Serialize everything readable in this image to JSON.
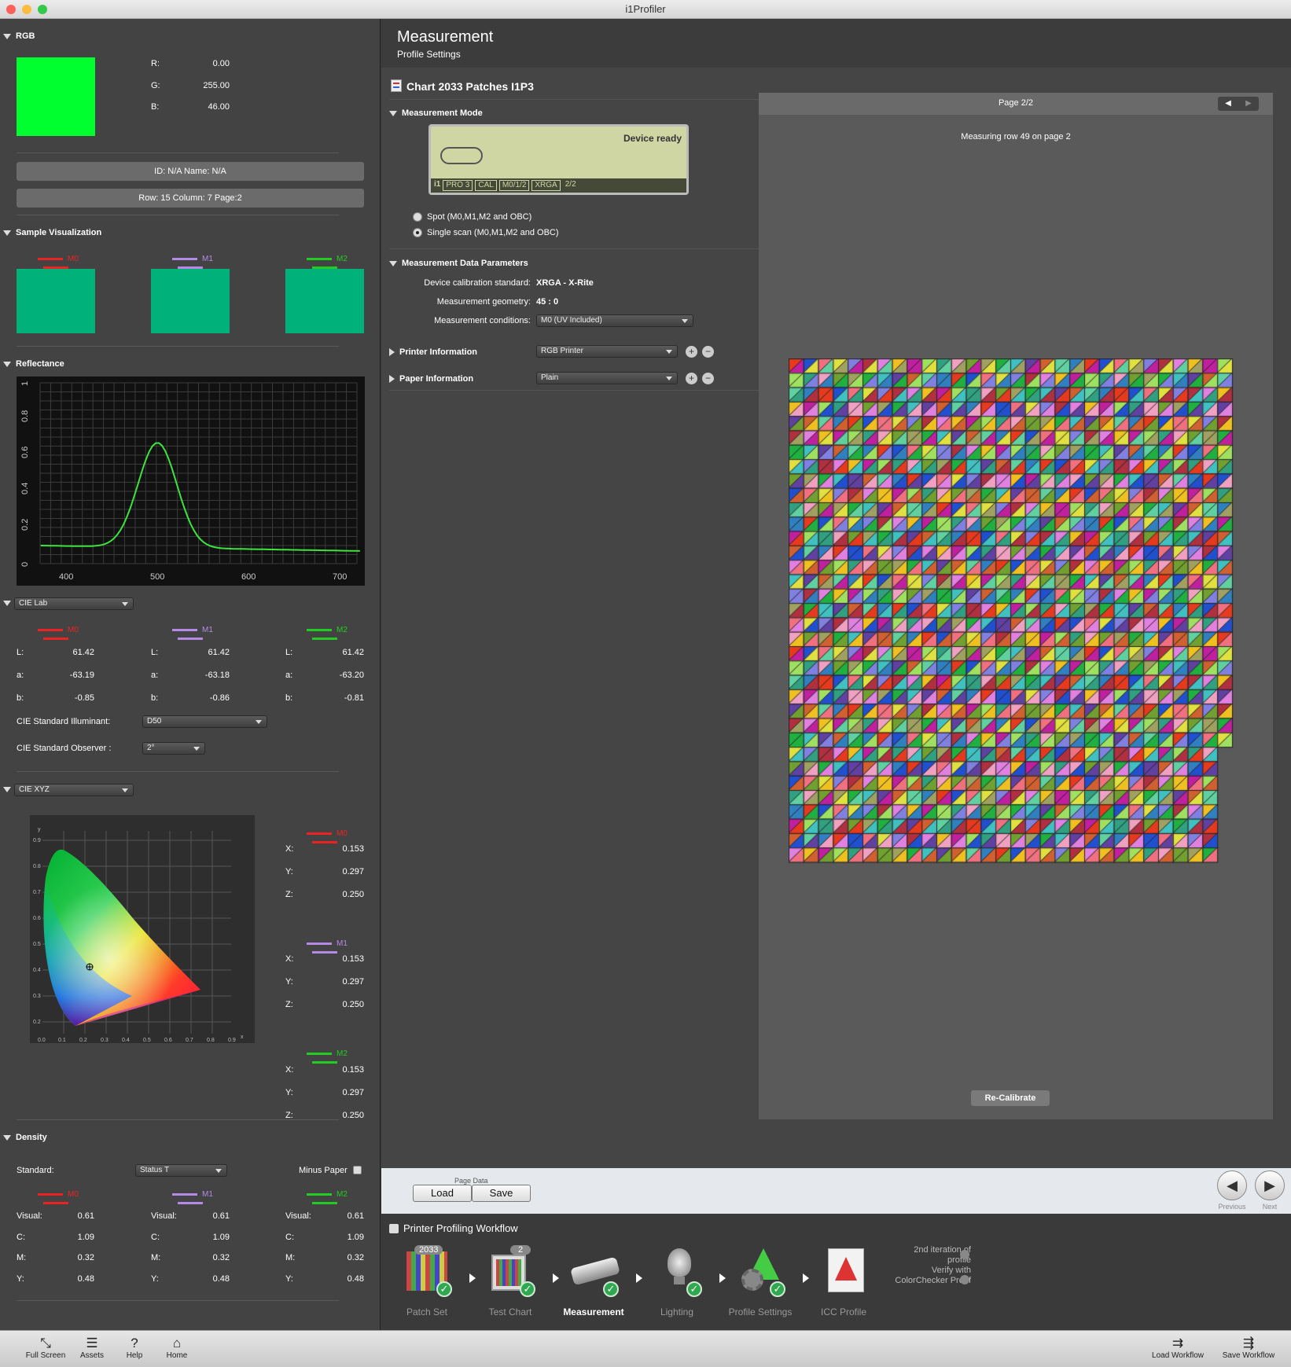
{
  "window": {
    "title": "i1Profiler"
  },
  "rgb": {
    "heading": "RGB",
    "swatch_color": "#00ff2e",
    "r_label": "R:",
    "r": "0.00",
    "g_label": "G:",
    "g": "255.00",
    "b_label": "B:",
    "b": "46.00",
    "id_name": "ID: N/A     Name: N/A",
    "row_col_page": "Row: 15    Column: 7    Page:2"
  },
  "sample": {
    "heading": "Sample Visualization",
    "m0": "M0",
    "m1": "M1",
    "m2": "M2",
    "color": "#00b17a"
  },
  "reflectance": {
    "heading": "Reflectance",
    "yticks": [
      "0",
      "0.2",
      "0.4",
      "0.6",
      "0.8",
      "1"
    ],
    "xticks": [
      "400",
      "500",
      "600",
      "700"
    ]
  },
  "lab": {
    "dropdown": "CIE Lab",
    "m0": "M0",
    "m1": "M1",
    "m2": "M2",
    "L_label": "L:",
    "a_label": "a:",
    "b_label": "b:",
    "cols": [
      {
        "L": "61.42",
        "a": "-63.19",
        "b": "-0.85"
      },
      {
        "L": "61.42",
        "a": "-63.18",
        "b": "-0.86"
      },
      {
        "L": "61.42",
        "a": "-63.20",
        "b": "-0.81"
      }
    ],
    "illuminant_label": "CIE Standard Illuminant:",
    "illuminant": "D50",
    "observer_label": "CIE Standard Observer :",
    "observer": "2°"
  },
  "xyz": {
    "dropdown": "CIE XYZ",
    "m0": "M0",
    "m1": "M1",
    "m2": "M2",
    "X_label": "X:",
    "Y_label": "Y:",
    "Z_label": "Z:",
    "groups": [
      {
        "X": "0.153",
        "Y": "0.297",
        "Z": "0.250"
      },
      {
        "X": "0.153",
        "Y": "0.297",
        "Z": "0.250"
      },
      {
        "X": "0.153",
        "Y": "0.297",
        "Z": "0.250"
      }
    ]
  },
  "density": {
    "heading": "Density",
    "standard_label": "Standard:",
    "standard": "Status T",
    "minus_paper": "Minus Paper",
    "m0": "M0",
    "m1": "M1",
    "m2": "M2",
    "visual_label": "Visual:",
    "c_label": "C:",
    "m_label": "M:",
    "y_label": "Y:",
    "cols": [
      {
        "visual": "0.61",
        "c": "1.09",
        "m": "0.32",
        "y": "0.48"
      },
      {
        "visual": "0.61",
        "c": "1.09",
        "m": "0.32",
        "y": "0.48"
      },
      {
        "visual": "0.61",
        "c": "1.09",
        "m": "0.32",
        "y": "0.48"
      }
    ]
  },
  "header": {
    "title": "Measurement",
    "subtitle": "Profile Settings"
  },
  "chart": {
    "title": "Chart 2033 Patches I1P3"
  },
  "mode": {
    "heading": "Measurement Mode",
    "lcd_status": "Device ready",
    "lcd_device": "i1",
    "lcd_pro": "PRO 3",
    "lcd_cal": "CAL",
    "lcd_m": "M0/1/2",
    "lcd_xrga": "XRGA",
    "lcd_page": "2/2",
    "spot": "Spot (M0,M1,M2 and OBC)",
    "single": "Single scan (M0,M1,M2 and OBC)"
  },
  "params": {
    "heading": "Measurement Data Parameters",
    "cal_label": "Device calibration standard:",
    "cal": "XRGA - X-Rite",
    "geo_label": "Measurement geometry:",
    "geo": "45 : 0",
    "cond_label": "Measurement conditions:",
    "cond": "M0 (UV Included)"
  },
  "printer": {
    "heading": "Printer Information",
    "value": "RGB Printer"
  },
  "paper": {
    "heading": "Paper Information",
    "value": "Plain"
  },
  "page_view": {
    "page": "Page 2/2",
    "status": "Measuring row 49 on page 2",
    "recalibrate": "Re-Calibrate"
  },
  "page_data": {
    "label": "Page Data",
    "load": "Load",
    "save": "Save",
    "previous": "Previous",
    "next": "Next"
  },
  "workflow": {
    "title": "Printer Profiling Workflow",
    "patch_badge": "2033",
    "chart_badge": "2",
    "steps": [
      "Patch Set",
      "Test Chart",
      "Measurement",
      "Lighting",
      "Profile Settings",
      "ICC Profile"
    ],
    "iter": "2nd iteration of profile",
    "verify": "Verify with ColorChecker Proof"
  },
  "bottom": {
    "full_screen": "Full Screen",
    "assets": "Assets",
    "help": "Help",
    "home": "Home",
    "load_wf": "Load Workflow",
    "save_wf": "Save Workflow"
  }
}
